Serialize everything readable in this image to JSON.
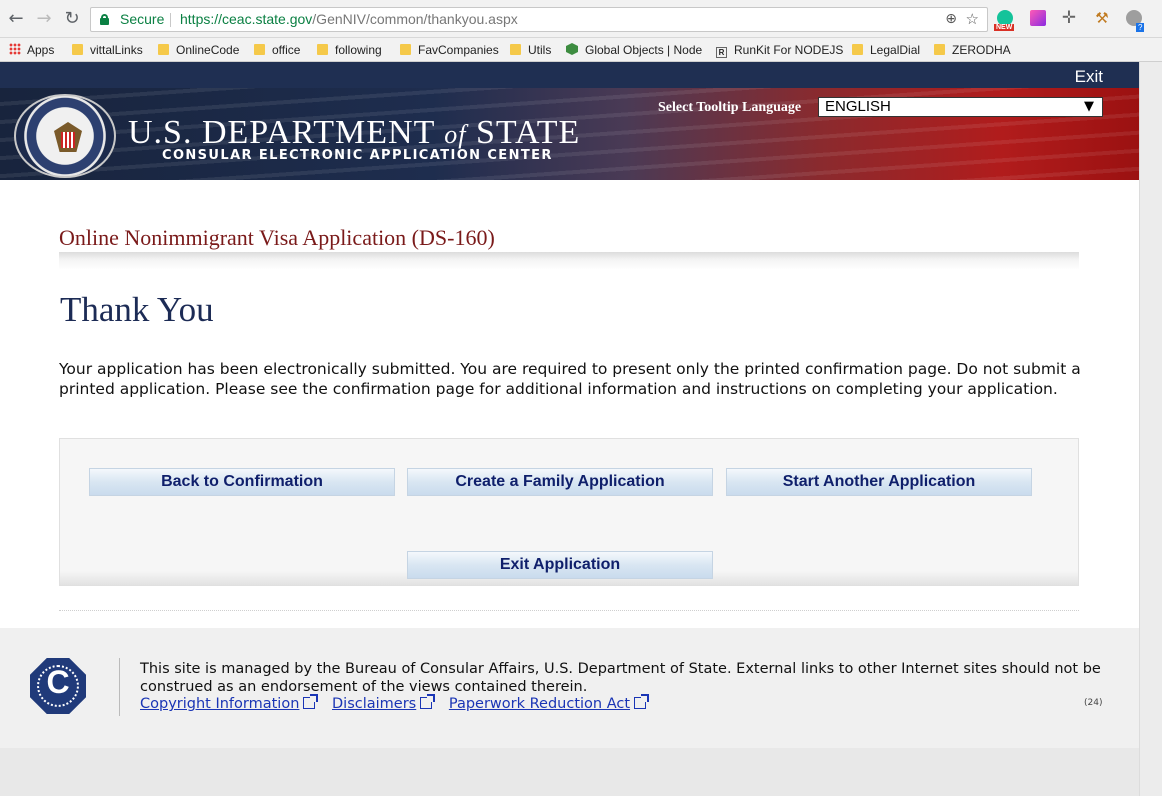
{
  "browser": {
    "secure_label": "Secure",
    "url_host": "https://ceac.state.gov",
    "url_path": "/GenNIV/common/thankyou.aspx",
    "ext_new_badge": "NEW",
    "ext_count_badge": "?",
    "bookmarks": [
      {
        "label": "Apps",
        "icon": "apps-grid-icon"
      },
      {
        "label": "vittalLinks",
        "icon": "folder-icon"
      },
      {
        "label": "OnlineCode",
        "icon": "folder-icon"
      },
      {
        "label": "office",
        "icon": "folder-icon"
      },
      {
        "label": "following",
        "icon": "folder-icon"
      },
      {
        "label": "FavCompanies",
        "icon": "folder-icon"
      },
      {
        "label": "Utils",
        "icon": "folder-icon"
      },
      {
        "label": "Global Objects | Node",
        "icon": "nodejs-icon"
      },
      {
        "label": "RunKit For NODEJS",
        "icon": "runkit-icon"
      },
      {
        "label": "LegalDial",
        "icon": "folder-icon"
      },
      {
        "label": "ZERODHA",
        "icon": "folder-icon"
      }
    ]
  },
  "header": {
    "exit_label": "Exit",
    "dept_title_a": "U.S. DEPARTMENT",
    "dept_title_of": "of",
    "dept_title_b": "STATE",
    "ceac_subtitle": "CONSULAR ELECTRONIC APPLICATION CENTER",
    "tooltip_label": "Select Tooltip Language",
    "tooltip_language": "ENGLISH"
  },
  "main": {
    "app_title": "Online Nonimmigrant Visa Application (DS-160)",
    "thank_you": "Thank You",
    "message": "Your application has been electronically submitted. You are required to present only the printed confirmation page. Do not submit a printed application. Please see the confirmation page for additional information and instructions on completing your application.",
    "buttons": {
      "back": "Back to Confirmation",
      "family": "Create a Family Application",
      "another": "Start Another Application",
      "exit": "Exit Application"
    }
  },
  "footer": {
    "badge_letter": "C",
    "text": "This site is managed by the Bureau of Consular Affairs, U.S. Department of State. External links to other Internet sites should not be construed as an endorsement of the views contained therein.",
    "links": {
      "copyright": "Copyright Information",
      "disclaimers": "Disclaimers",
      "paperwork": "Paperwork Reduction Act"
    },
    "version": "(24)"
  },
  "colors": {
    "header_navy": "#1f2f52",
    "title_maroon": "#7a1a1a",
    "heading_navy": "#1c2b55",
    "button_text": "#0f1f6b",
    "link_blue": "#1a35b5",
    "secure_green": "#0b8043"
  }
}
